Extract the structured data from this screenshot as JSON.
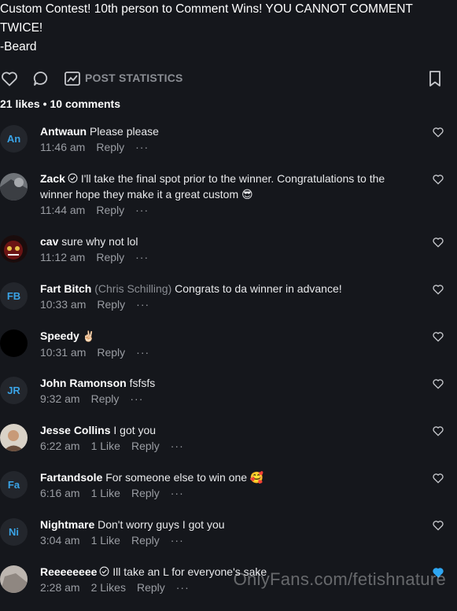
{
  "post": {
    "lines": [
      "Custom Contest! 10th person to Comment Wins! YOU CANNOT COMMENT",
      "TWICE!",
      "-Beard"
    ]
  },
  "actions": {
    "like_icon": "heart-outline-icon",
    "comment_icon": "speech-bubble-icon",
    "stats_icon": "chart-icon",
    "stats_label": "POST STATISTICS",
    "bookmark_icon": "bookmark-icon"
  },
  "summary": {
    "likes": "21 likes",
    "separator": "•",
    "comments": "10 comments"
  },
  "comments": [
    {
      "avatar": "An",
      "name": "Antwaun",
      "alias": "",
      "text": "Please please",
      "time": "11:46 am",
      "likes": "",
      "reply": "Reply",
      "more": "···"
    },
    {
      "avatar": "",
      "name": "Zack",
      "verified": true,
      "text": "I'll take the final spot prior to the winner. Congratulations to the winner hope they make it a great custom 😎",
      "time": "11:44 am",
      "likes": "",
      "reply": "Reply",
      "more": "···"
    },
    {
      "avatar": "",
      "name": "cav",
      "text": "sure why not lol",
      "time": "11:12 am",
      "likes": "",
      "reply": "Reply",
      "more": "···"
    },
    {
      "avatar": "FB",
      "name": "Fart Bitch",
      "alias": "(Chris Schilling)",
      "text": "Congrats to da winner in advance!",
      "time": "10:33 am",
      "likes": "",
      "reply": "Reply",
      "more": "···"
    },
    {
      "avatar": "",
      "name": "Speedy",
      "text": "✌🏻",
      "time": "10:31 am",
      "likes": "",
      "reply": "Reply",
      "more": "···"
    },
    {
      "avatar": "JR",
      "name": "John Ramonson",
      "text": "fsfsfs",
      "time": "9:32 am",
      "likes": "",
      "reply": "Reply",
      "more": "···"
    },
    {
      "avatar": "",
      "name": "Jesse Collins",
      "text": "I got you",
      "time": "6:22 am",
      "likes": "1 Like",
      "reply": "Reply",
      "more": "···"
    },
    {
      "avatar": "Fa",
      "name": "Fartandsole",
      "text": "For someone else to win one 🥰",
      "time": "6:16 am",
      "likes": "1 Like",
      "reply": "Reply",
      "more": "···"
    },
    {
      "avatar": "Ni",
      "name": "Nightmare",
      "text": "Don't worry guys I got you",
      "time": "3:04 am",
      "likes": "1 Like",
      "reply": "Reply",
      "more": "···"
    },
    {
      "avatar": "",
      "name": "Reeeeeeee",
      "verified": true,
      "text": "Ill take an L for everyone's sake",
      "time": "2:28 am",
      "likes": "2 Likes",
      "reply": "Reply",
      "more": "···"
    }
  ],
  "colors": {
    "background": "#15171c",
    "accent": "#3aa3e6",
    "muted": "#9a9da3",
    "liked": "#2ea6f2"
  },
  "watermark": "OnlyFans.com/fetishnature"
}
